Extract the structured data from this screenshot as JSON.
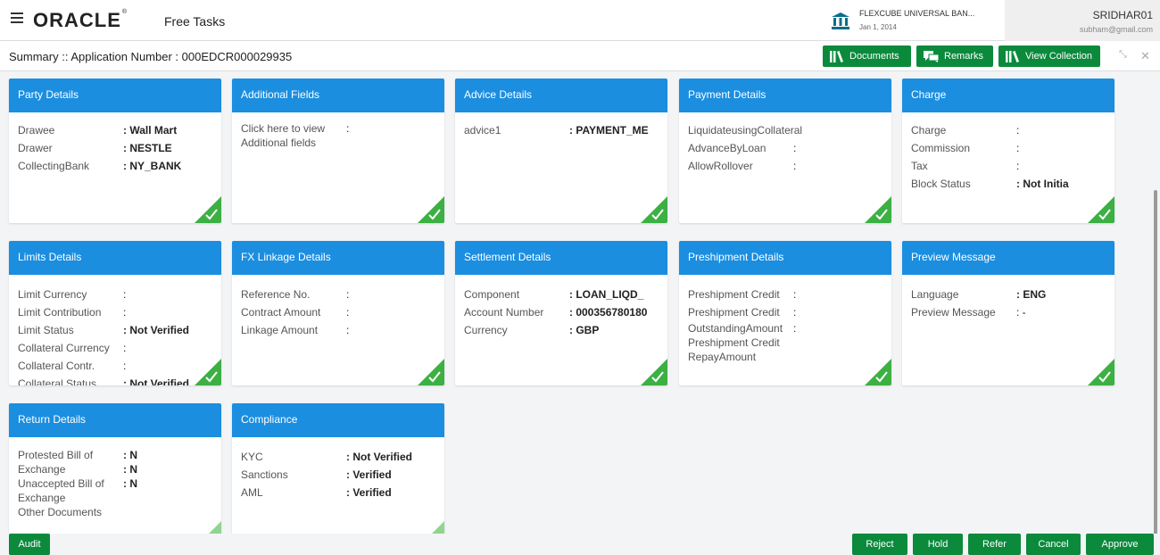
{
  "header": {
    "logo": "ORACLE",
    "page_title": "Free Tasks",
    "bank_name": "FLEXCUBE UNIVERSAL BAN...",
    "bank_date": "Jan 1, 2014",
    "user_name": "SRIDHAR01",
    "user_email": "subham@gmail.com"
  },
  "summary": {
    "title": "Summary :: Application Number : 000EDCR000029935",
    "buttons": {
      "documents": "Documents",
      "remarks": "Remarks",
      "view_collection": "View Collection"
    }
  },
  "cards": {
    "party": {
      "title": "Party Details",
      "rows": [
        {
          "label": "Drawee",
          "value": ": Wall Mart"
        },
        {
          "label": "Drawer",
          "value": ": NESTLE"
        },
        {
          "label": "CollectingBank",
          "value": ": NY_BANK"
        }
      ]
    },
    "additional": {
      "title": "Additional Fields",
      "line1": "Click here to view",
      "line2": "Additional fields",
      "colon": ":"
    },
    "advice": {
      "title": "Advice Details",
      "rows": [
        {
          "label": "advice1",
          "value": ": PAYMENT_ME"
        }
      ]
    },
    "payment": {
      "title": "Payment Details",
      "rows": [
        {
          "label": "LiquidateusingCollateral",
          "value": ""
        },
        {
          "label": "AdvanceByLoan",
          "value": ":"
        },
        {
          "label": "AllowRollover",
          "value": ":"
        }
      ]
    },
    "charge": {
      "title": "Charge",
      "rows": [
        {
          "label": "Charge",
          "value": ":"
        },
        {
          "label": "Commission",
          "value": ":"
        },
        {
          "label": "Tax",
          "value": ":"
        },
        {
          "label": "Block Status",
          "value": ": Not Initia"
        }
      ]
    },
    "limits": {
      "title": "Limits Details",
      "rows": [
        {
          "label": "Limit Currency",
          "value": ":"
        },
        {
          "label": "Limit Contribution",
          "value": ":"
        },
        {
          "label": "Limit Status",
          "value": ": Not Verified"
        },
        {
          "label": "Collateral Currency",
          "value": ":"
        },
        {
          "label": "Collateral Contr.",
          "value": ":"
        },
        {
          "label": "Collateral Status",
          "value": ": Not Verified"
        }
      ]
    },
    "fx": {
      "title": "FX Linkage Details",
      "rows": [
        {
          "label": "Reference No.",
          "value": ":"
        },
        {
          "label": "Contract Amount",
          "value": ":"
        },
        {
          "label": "Linkage Amount",
          "value": ":"
        }
      ]
    },
    "settlement": {
      "title": "Settlement Details",
      "rows": [
        {
          "label": "Component",
          "value": ": LOAN_LIQD_"
        },
        {
          "label": "Account Number",
          "value": ": 000356780180"
        },
        {
          "label": "Currency",
          "value": ": GBP"
        }
      ]
    },
    "preshipment": {
      "title": "Preshipment Details",
      "rows": [
        {
          "label": "Preshipment Credit",
          "value": ":"
        },
        {
          "label": "Preshipment Credit",
          "value": ":"
        },
        {
          "label": "OutstandingAmount",
          "value": ":"
        }
      ],
      "extra1": "Preshipment Credit",
      "extra2": "RepayAmount"
    },
    "preview": {
      "title": "Preview Message",
      "rows": [
        {
          "label": "Language",
          "value": ": ENG"
        },
        {
          "label": "Preview Message",
          "value": ": -"
        }
      ]
    },
    "return": {
      "title": "Return Details",
      "rows": [
        {
          "label": "Protested Bill of",
          "value": ": N"
        },
        {
          "label": "Exchange",
          "value": ": N"
        },
        {
          "label": "Unaccepted Bill of",
          "value": ": N"
        },
        {
          "label": "Exchange",
          "value": ""
        },
        {
          "label": "Other Documents",
          "value": ""
        }
      ]
    },
    "compliance": {
      "title": "Compliance",
      "rows": [
        {
          "label": "KYC",
          "value": ": Not Verified"
        },
        {
          "label": "Sanctions",
          "value": ": Verified"
        },
        {
          "label": "AML",
          "value": ": Verified"
        }
      ]
    }
  },
  "footer": {
    "audit": "Audit",
    "reject": "Reject",
    "hold": "Hold",
    "refer": "Refer",
    "cancel": "Cancel",
    "approve": "Approve"
  },
  "colors": {
    "card_header": "#1b8ee0",
    "button": "#0b8a3c",
    "check": "#3cb043"
  },
  "icons": {
    "menu": "hamburger-icon",
    "bank": "bank-icon",
    "documents": "library-icon",
    "remarks": "chat-icon",
    "collection": "library-icon",
    "card_status": "check-icon"
  }
}
